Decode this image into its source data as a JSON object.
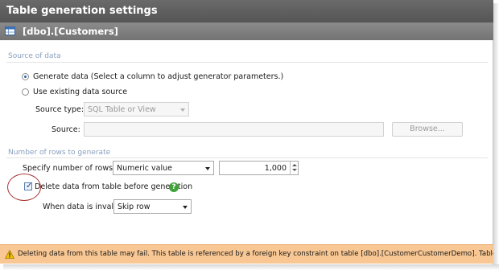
{
  "window": {
    "title": "Table generation settings"
  },
  "table": {
    "name": "[dbo].[Customers]",
    "icon": "table-icon"
  },
  "source_of_data": {
    "section_label": "Source of data",
    "generate_label": "Generate data (Select a column to adjust generator parameters.)",
    "existing_label": "Use existing data source",
    "selected": "generate",
    "source_type_label": "Source type:",
    "source_type_value": "SQL Table or View",
    "source_label": "Source:",
    "source_value": "",
    "browse_label": "Browse..."
  },
  "rows": {
    "section_label": "Number of rows to generate",
    "specify_label": "Specify number of rows by:",
    "specify_value": "Numeric value",
    "count_value": "1,000",
    "delete_label": "Delete data from table before generation",
    "delete_checked": true,
    "help_icon": "help-icon",
    "invalid_label": "When data is invalid:",
    "invalid_value": "Skip row"
  },
  "warning": {
    "icon": "warning-icon",
    "text": "Deleting data from this table may fail. This table is referenced by a foreign key constraint on table [dbo].[CustomerCustomerDemo]. Table [dbo].[C..."
  },
  "colors": {
    "accent": "#2b5ea8",
    "section_label": "#8aa0bf",
    "warning_bg": "#f8c793",
    "highlight_circle": "#a83434"
  }
}
